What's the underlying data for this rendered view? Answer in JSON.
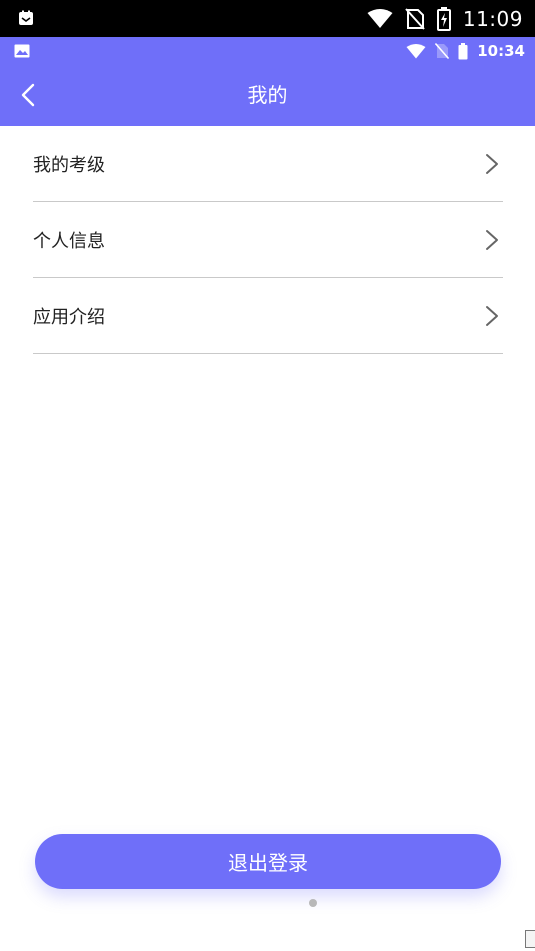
{
  "status_bar": {
    "time": "11:09",
    "icons": [
      "notification-app-icon",
      "wifi-icon",
      "no-sim-icon",
      "battery-charging-icon"
    ]
  },
  "inner_status_bar": {
    "time": "10:34",
    "icons": [
      "image-icon",
      "wifi-icon",
      "no-sim-icon",
      "battery-icon"
    ]
  },
  "header": {
    "title": "我的",
    "back_icon": "chevron-left-icon"
  },
  "menu": {
    "items": [
      {
        "label": "我的考级",
        "icon": "chevron-right-icon"
      },
      {
        "label": "个人信息",
        "icon": "chevron-right-icon"
      },
      {
        "label": "应用介绍",
        "icon": "chevron-right-icon"
      }
    ]
  },
  "actions": {
    "logout_label": "退出登录"
  },
  "colors": {
    "accent": "#6f6ff9",
    "divider": "#c9c9c9",
    "text": "#222222"
  }
}
